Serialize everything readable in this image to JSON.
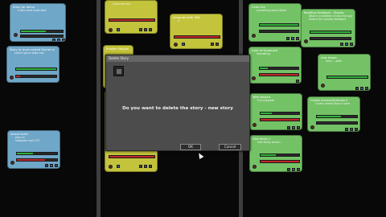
{
  "board": {
    "col1": [
      {
        "title": "Story for demo",
        "sub": "a title need know best",
        "progress": 0.6,
        "color": "blue"
      },
      {
        "title": "Story to show nested Stories in",
        "sub": "Lorem ipsum dolor suit",
        "progress": 0.5,
        "color": "blue"
      },
      {
        "title": "Ahmet build",
        "sub": "plan co",
        "sub2": "integrate mod 123",
        "progress": 0.3,
        "color": "blue"
      }
    ],
    "col2": [
      {
        "title": "",
        "sub": "Comment red",
        "progress": 0.4,
        "color": "yellow"
      },
      {
        "title": "Integrate with Wiki",
        "sub": "a",
        "progress": 0.0,
        "color": "yellow"
      },
      {
        "title": "Problem Report",
        "sub": "",
        "progress": 0.4,
        "color": "yellow"
      },
      {
        "title": "",
        "sub": "",
        "progress": 0.4,
        "color": "yellow"
      }
    ],
    "col3": [
      {
        "title": "Color link",
        "sub": "something about detail",
        "progress": 0.6,
        "color": "green"
      },
      {
        "title": "Realtime feedback - Stories",
        "sub": "What is a realtime UI and the system",
        "sub2": "Search the solution feedback",
        "progress": 0.7,
        "color": "green"
      },
      {
        "title": "Look at Scorecard",
        "sub": "Something",
        "progress": 0.3,
        "color": "green"
      },
      {
        "title": "new shows",
        "sub": "love......walk",
        "progress": 0.5,
        "color": "green"
      },
      {
        "title": "With Nested",
        "sub": "Full integrate",
        "progress": 0.4,
        "color": "green"
      },
      {
        "title": "Create screens/features II",
        "sub": "Create nested flow in store",
        "progress": 0.5,
        "color": "green"
      },
      {
        "title": "New Items 1",
        "sub": "new sticky board....",
        "progress": 0.3,
        "color": "green"
      }
    ]
  },
  "dialog": {
    "title": "Delete Story",
    "message": "Do you want to delete the story - new story",
    "ok": "OK",
    "cancel": "Cancel"
  }
}
